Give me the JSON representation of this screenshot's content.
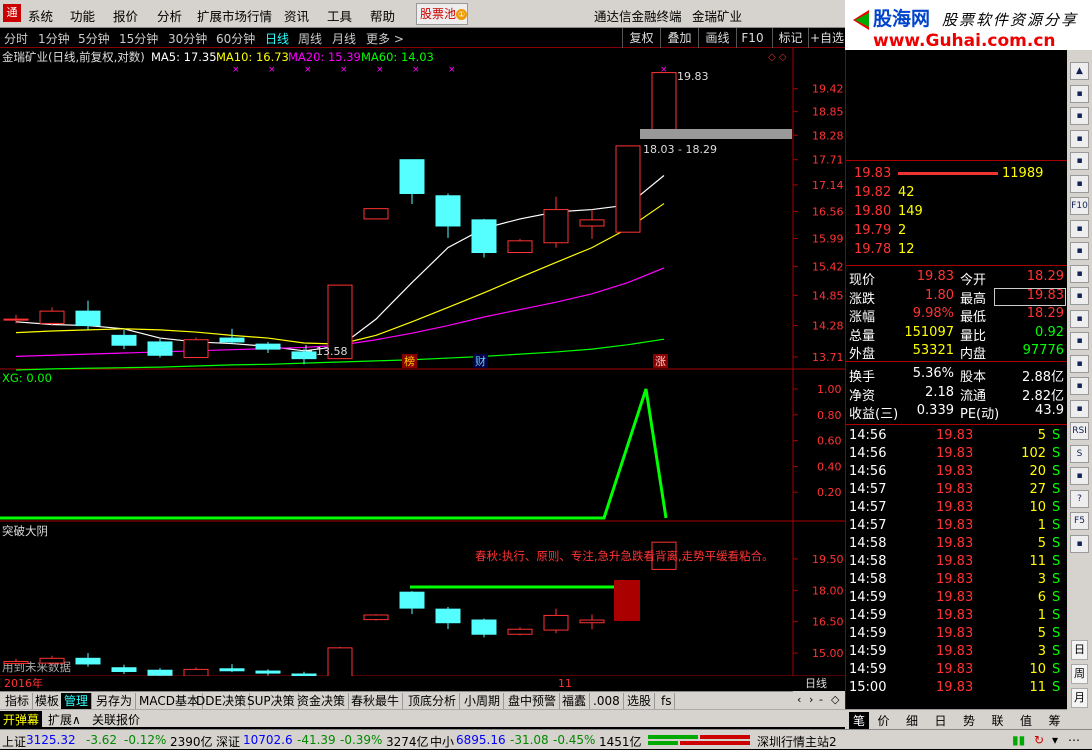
{
  "menu": {
    "items": [
      "系统",
      "功能",
      "报价",
      "分析",
      "扩展市场行情",
      "资讯",
      "工具",
      "帮助"
    ],
    "stock_pool": "股票池",
    "stock_pool_badge": "①",
    "title_app": "通达信金融终端",
    "title_stock": "金瑞矿业"
  },
  "brand": {
    "name": "股海网",
    "slogan": "股票软件资源分享",
    "url": "www.Guhai.com.cn"
  },
  "periods": {
    "items": [
      "分时",
      "1分钟",
      "5分钟",
      "15分钟",
      "30分钟",
      "60分钟",
      "日线",
      "周线",
      "月线",
      "更多 >"
    ],
    "selected": "日线"
  },
  "right_buttons": [
    "复权",
    "叠加",
    "画线",
    "F10",
    "标记",
    "+自选"
  ],
  "main_chart": {
    "header_name": "金瑞矿业(日线,前复权,对数)",
    "ma5": "MA5: 17.35",
    "ma10": "MA10: 16.73",
    "ma20": "MA20: 15.39",
    "ma60": "MA60: 14.03",
    "high_label": "19.83",
    "low_label": "13.58",
    "range_label": "18.03 - 18.29",
    "markers": [
      "榜",
      "财",
      "涨"
    ],
    "price_ticks": [
      "19.42",
      "18.85",
      "18.28",
      "17.71",
      "17.14",
      "16.56",
      "15.99",
      "15.42",
      "14.85",
      "14.28",
      "13.71"
    ]
  },
  "xg_panel": {
    "header": "XG: 0.00",
    "ticks": [
      "1.00",
      "0.80",
      "0.60",
      "0.40",
      "0.20"
    ]
  },
  "third_panel": {
    "header": "突破大阴",
    "annotation": "春秋:执行、原则、专注,急升急跌看背离,走势平缓看粘合。",
    "footer_note": "用到未来数据",
    "ticks": [
      "19.50",
      "18.00",
      "16.50",
      "15.00"
    ]
  },
  "date_axis": {
    "year": "2016年",
    "month": "11",
    "period": "日线"
  },
  "chart_data": [
    {
      "type": "candlestick",
      "title": "金瑞矿业(日线,前复权,对数)",
      "candles": [
        {
          "o": 14.4,
          "c": 14.4,
          "h": 14.48,
          "l": 14.32,
          "dir": "up"
        },
        {
          "o": 14.32,
          "c": 14.55,
          "h": 14.62,
          "l": 14.28,
          "dir": "up"
        },
        {
          "o": 14.55,
          "c": 14.28,
          "h": 14.75,
          "l": 14.2,
          "dir": "down"
        },
        {
          "o": 14.1,
          "c": 13.92,
          "h": 14.2,
          "l": 13.85,
          "dir": "down"
        },
        {
          "o": 13.98,
          "c": 13.74,
          "h": 14.03,
          "l": 13.7,
          "dir": "down"
        },
        {
          "o": 13.7,
          "c": 14.02,
          "h": 14.06,
          "l": 13.7,
          "dir": "up"
        },
        {
          "o": 14.05,
          "c": 13.98,
          "h": 14.22,
          "l": 13.94,
          "dir": "down"
        },
        {
          "o": 13.94,
          "c": 13.85,
          "h": 13.98,
          "l": 13.78,
          "dir": "down"
        },
        {
          "o": 13.8,
          "c": 13.68,
          "h": 13.86,
          "l": 13.58,
          "dir": "down"
        },
        {
          "o": 13.68,
          "c": 15.05,
          "h": 15.05,
          "l": 13.68,
          "dir": "up"
        },
        {
          "o": 16.4,
          "c": 16.62,
          "h": 16.62,
          "l": 16.4,
          "dir": "up"
        },
        {
          "o": 17.71,
          "c": 16.95,
          "h": 17.71,
          "l": 16.72,
          "dir": "down"
        },
        {
          "o": 16.9,
          "c": 16.25,
          "h": 16.95,
          "l": 16.0,
          "dir": "down"
        },
        {
          "o": 16.38,
          "c": 15.7,
          "h": 16.4,
          "l": 15.6,
          "dir": "down"
        },
        {
          "o": 15.7,
          "c": 15.94,
          "h": 15.98,
          "l": 15.7,
          "dir": "up"
        },
        {
          "o": 15.9,
          "c": 16.6,
          "h": 16.88,
          "l": 15.8,
          "dir": "up"
        },
        {
          "o": 16.25,
          "c": 16.38,
          "h": 16.6,
          "l": 15.98,
          "dir": "up"
        },
        {
          "o": 16.12,
          "c": 18.03,
          "h": 18.03,
          "l": 16.12,
          "dir": "up"
        },
        {
          "o": 18.29,
          "c": 19.83,
          "h": 19.83,
          "l": 18.29,
          "dir": "up"
        }
      ],
      "series": [
        {
          "name": "MA5",
          "color": "#ffffff",
          "values": [
            14.35,
            14.3,
            14.28,
            14.22,
            14.05,
            13.98,
            13.95,
            13.9,
            13.82,
            13.9,
            14.4,
            15.1,
            15.8,
            16.2,
            16.4,
            16.55,
            16.6,
            16.7,
            17.35
          ]
        },
        {
          "name": "MA10",
          "color": "#ffff00",
          "values": [
            14.15,
            14.18,
            14.2,
            14.22,
            14.2,
            14.16,
            14.1,
            14.05,
            13.96,
            13.94,
            14.1,
            14.35,
            14.62,
            14.9,
            15.2,
            15.5,
            15.8,
            16.2,
            16.73
          ]
        },
        {
          "name": "MA20",
          "color": "#ff00ff",
          "values": [
            13.72,
            13.74,
            13.76,
            13.78,
            13.8,
            13.82,
            13.84,
            13.86,
            13.88,
            13.92,
            14.02,
            14.14,
            14.28,
            14.44,
            14.58,
            14.72,
            14.88,
            15.1,
            15.39
          ]
        },
        {
          "name": "MA60",
          "color": "#00ff00",
          "values": [
            13.48,
            13.5,
            13.51,
            13.52,
            13.53,
            13.55,
            13.57,
            13.58,
            13.6,
            13.62,
            13.64,
            13.66,
            13.69,
            13.72,
            13.76,
            13.8,
            13.85,
            13.93,
            14.03
          ]
        }
      ],
      "ylim": [
        13.55,
        20.0
      ]
    },
    {
      "type": "line",
      "title": "XG: 0.00",
      "series": [
        {
          "name": "XG",
          "values": [
            0,
            0,
            0,
            0,
            0,
            0,
            0,
            0,
            0,
            0,
            0,
            0,
            0,
            0,
            0,
            0,
            0,
            1,
            0
          ]
        }
      ],
      "ylim": [
        0,
        1.0
      ]
    },
    {
      "type": "candlestick",
      "title": "突破大阴",
      "ylim": [
        14.0,
        20.5
      ]
    }
  ],
  "quote": {
    "sell": [
      {
        "price": "19.83",
        "vol": "11989"
      }
    ],
    "buy": [
      {
        "price": "19.82",
        "vol": "42"
      },
      {
        "price": "19.80",
        "vol": "149"
      },
      {
        "price": "19.79",
        "vol": "2"
      },
      {
        "price": "19.78",
        "vol": "12"
      }
    ],
    "stats": [
      {
        "l1": "现价",
        "v1": "19.83",
        "l2": "今开",
        "v2": "18.29"
      },
      {
        "l1": "涨跌",
        "v1": "1.80",
        "l2": "最高",
        "v2": "19.83"
      },
      {
        "l1": "涨幅",
        "v1": "9.98%",
        "l2": "最低",
        "v2": "18.29"
      },
      {
        "l1": "总量",
        "v1": "151097",
        "l2": "量比",
        "v2": "0.92"
      },
      {
        "l1": "外盘",
        "v1": "53321",
        "l2": "内盘",
        "v2": "97776"
      }
    ],
    "fin": [
      {
        "l1": "换手",
        "v1": "5.36%",
        "l2": "股本",
        "v2": "2.88亿"
      },
      {
        "l1": "净资",
        "v1": "2.18",
        "l2": "流通",
        "v2": "2.82亿"
      },
      {
        "l1": "收益(三)",
        "v1": "0.339",
        "l2": "PE(动)",
        "v2": "43.9"
      }
    ],
    "ticks": [
      {
        "t": "14:56",
        "p": "19.83",
        "v": "5",
        "d": "S"
      },
      {
        "t": "14:56",
        "p": "19.83",
        "v": "102",
        "d": "S"
      },
      {
        "t": "14:56",
        "p": "19.83",
        "v": "20",
        "d": "S"
      },
      {
        "t": "14:57",
        "p": "19.83",
        "v": "27",
        "d": "S"
      },
      {
        "t": "14:57",
        "p": "19.83",
        "v": "10",
        "d": "S"
      },
      {
        "t": "14:57",
        "p": "19.83",
        "v": "1",
        "d": "S"
      },
      {
        "t": "14:58",
        "p": "19.83",
        "v": "5",
        "d": "S"
      },
      {
        "t": "14:58",
        "p": "19.83",
        "v": "11",
        "d": "S"
      },
      {
        "t": "14:58",
        "p": "19.83",
        "v": "3",
        "d": "S"
      },
      {
        "t": "14:59",
        "p": "19.83",
        "v": "6",
        "d": "S"
      },
      {
        "t": "14:59",
        "p": "19.83",
        "v": "1",
        "d": "S"
      },
      {
        "t": "14:59",
        "p": "19.83",
        "v": "5",
        "d": "S"
      },
      {
        "t": "14:59",
        "p": "19.83",
        "v": "3",
        "d": "S"
      },
      {
        "t": "14:59",
        "p": "19.83",
        "v": "10",
        "d": "S"
      },
      {
        "t": "15:00",
        "p": "19.83",
        "v": "11",
        "d": "S"
      }
    ]
  },
  "quote_tabs": [
    "笔",
    "价",
    "细",
    "日",
    "势",
    "联",
    "值",
    "筹"
  ],
  "side_letters": [
    "日",
    "周",
    "月"
  ],
  "bottom_tabs": [
    "指标",
    "模板",
    "管理",
    "另存为",
    "MACD基本",
    "DDE决策",
    "SUP决策",
    "资金决策",
    "春秋最牛",
    "顶底分析",
    "小周期",
    "盘中预警",
    "福蠹",
    ".008",
    "选股",
    "fs"
  ],
  "bottom_tabs_selected": "管理",
  "tabs2": [
    "开弹幕",
    "扩展∧",
    "关联报价"
  ],
  "status": {
    "sh_name": "上证",
    "sh_val": "3125.32",
    "sh_chg": "-3.62",
    "sh_pct": "-0.12%",
    "sh_amt": "2390亿",
    "sz_name": "深证",
    "sz_val": "10702.6",
    "sz_chg": "-41.39",
    "sz_pct": "-0.39%",
    "sz_amt": "3274亿",
    "zx_name": "中小",
    "zx_val": "6895.16",
    "zx_chg": "-31.08",
    "zx_pct": "-0.45%",
    "zx_amt": "1451亿",
    "site": "深圳行情主站2"
  }
}
